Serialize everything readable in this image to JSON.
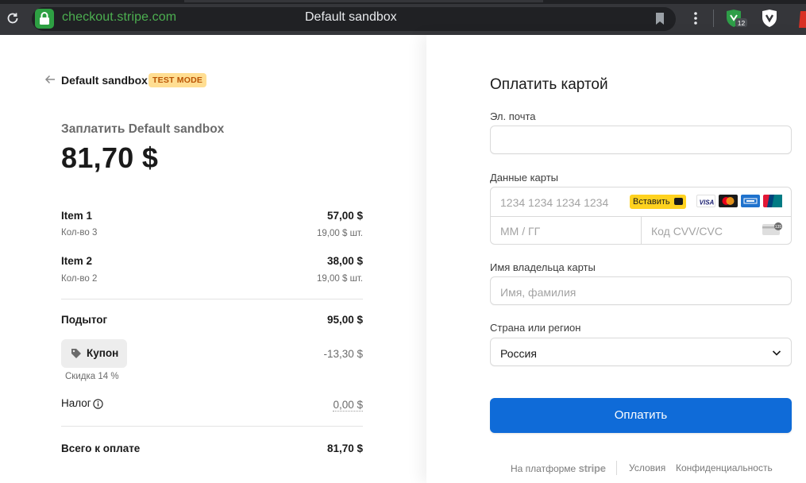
{
  "browser": {
    "url": "checkout.stripe.com",
    "title": "Default sandbox",
    "extension_badge": "12"
  },
  "summary": {
    "merchant": "Default sandbox",
    "test_mode": "TEST MODE",
    "pay_to": "Заплатить Default sandbox",
    "amount": "81,70 $",
    "items": [
      {
        "name": "Item 1",
        "qty": "Кол-во 3",
        "price": "57,00 $",
        "unit": "19,00 $ шт."
      },
      {
        "name": "Item 2",
        "qty": "Кол-во 2",
        "price": "38,00 $",
        "unit": "19,00 $ шт."
      }
    ],
    "subtotal_label": "Подытог",
    "subtotal_value": "95,00 $",
    "coupon_label": "Купон",
    "coupon_value": "-13,30 $",
    "discount_note": "Скидка 14 %",
    "tax_label": "Налог",
    "tax_value": "0,00 $",
    "total_label": "Всего к оплате",
    "total_value": "81,70 $"
  },
  "form": {
    "title": "Оплатить картой",
    "email_label": "Эл. почта",
    "email_value": "",
    "card_label": "Данные карты",
    "card_placeholder": "1234 1234 1234 1234",
    "paste_label": "Вставить",
    "brands": [
      "VISA",
      "mastercard-icon",
      "amex-icon",
      "unionpay-icon"
    ],
    "visa_label": "VISA",
    "expiry_placeholder": "ММ / ГГ",
    "cvc_placeholder": "Код CVV/CVC",
    "cvc_icon_text": "135",
    "name_label": "Имя владельца карты",
    "name_placeholder": "Имя, фамилия",
    "country_label": "Страна или регион",
    "country_value": "Россия",
    "pay_button": "Оплатить"
  },
  "footer": {
    "powered_by": "На платформе",
    "brand": "stripe",
    "terms": "Условия",
    "privacy": "Конфиденциальность"
  },
  "colors": {
    "pay_button": "#0f6bd8",
    "test_mode_bg": "#ffde92",
    "test_mode_text": "#bb5504",
    "url_green": "#4caf50"
  }
}
